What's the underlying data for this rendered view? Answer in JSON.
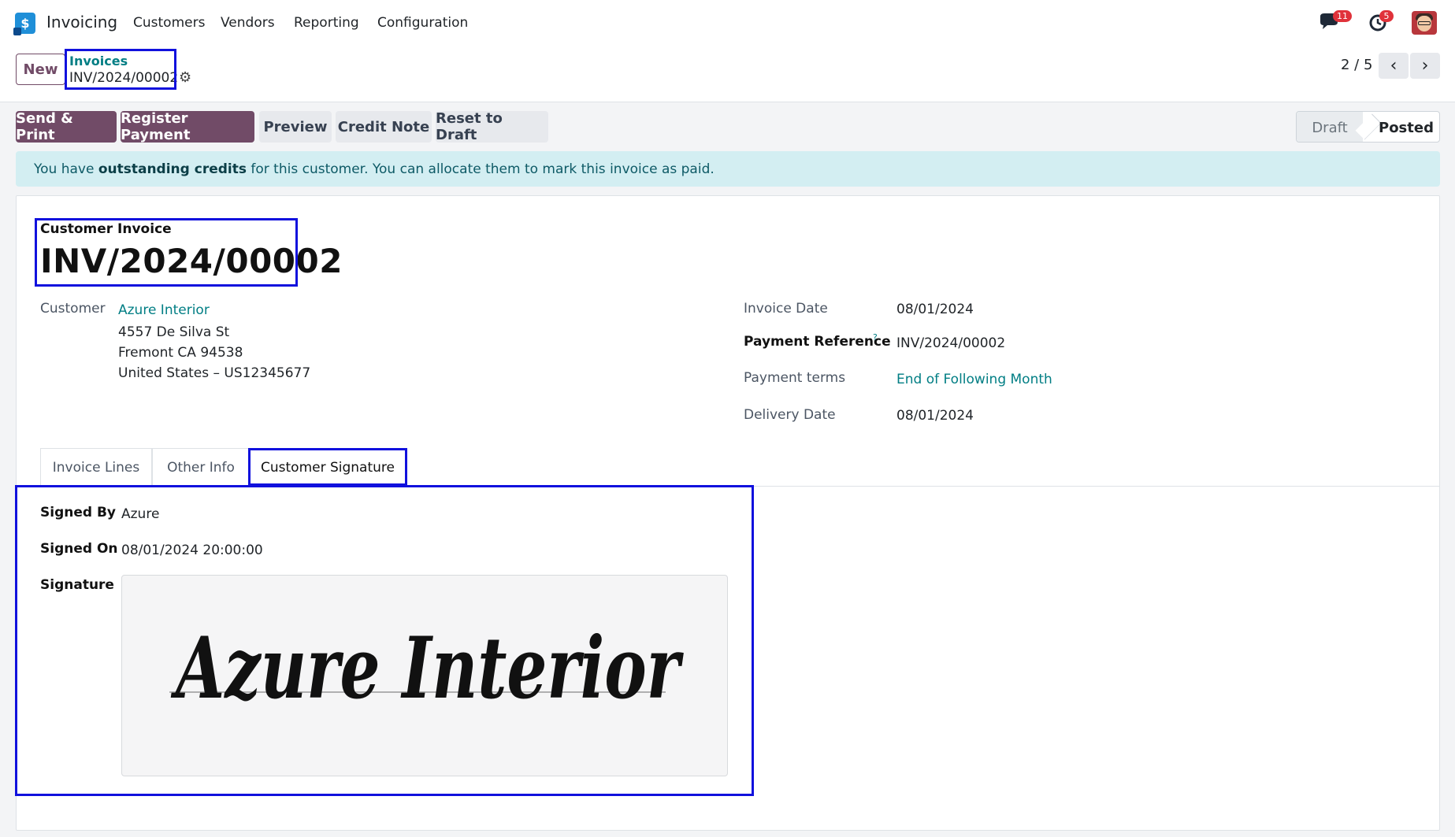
{
  "topbar": {
    "app_name": "Invoicing",
    "logo_glyph": "$",
    "nav": [
      "Customers",
      "Vendors",
      "Reporting",
      "Configuration"
    ],
    "messages_badge": "11",
    "activities_badge": "5"
  },
  "control": {
    "new_label": "New",
    "breadcrumb_parent": "Invoices",
    "breadcrumb_current": "INV/2024/00002",
    "gear_icon": "⚙",
    "pager_value": "2 / 5",
    "prev_glyph": "‹",
    "next_glyph": "›"
  },
  "actions": {
    "send_print": "Send & Print",
    "register_payment": "Register Payment",
    "preview": "Preview",
    "credit_note": "Credit Note",
    "reset_to_draft": "Reset to Draft"
  },
  "status": {
    "draft": "Draft",
    "posted": "Posted",
    "current": "Posted"
  },
  "alert": {
    "prefix": "You have ",
    "bold": "outstanding credits",
    "suffix": " for this customer. You can allocate them to mark this invoice as paid."
  },
  "invoice": {
    "type_label": "Customer Invoice",
    "number": "INV/2024/00002",
    "customer_label": "Customer",
    "customer_name": "Azure Interior",
    "address_line1": "4557 De Silva St",
    "address_line2": "Fremont CA 94538",
    "address_line3": "United States – US12345677",
    "invoice_date_label": "Invoice Date",
    "invoice_date": "08/01/2024",
    "payment_reference_label": "Payment Reference",
    "payment_reference_help": "?",
    "payment_reference": "INV/2024/00002",
    "payment_terms_label": "Payment terms",
    "payment_terms": "End of Following Month",
    "delivery_date_label": "Delivery Date",
    "delivery_date": "08/01/2024"
  },
  "tabs": [
    {
      "label": "Invoice Lines"
    },
    {
      "label": "Other Info"
    },
    {
      "label": "Customer Signature"
    }
  ],
  "signature_panel": {
    "signed_by_label": "Signed By",
    "signed_by": "Azure",
    "signed_on_label": "Signed On",
    "signed_on": "08/01/2024 20:00:00",
    "signature_label": "Signature",
    "signature_text": "Azure Interior"
  },
  "colors": {
    "primary": "#714b67",
    "link": "#017e84",
    "alert_bg": "#d3eef2",
    "highlight": "#1111dd",
    "badge": "#e0323a"
  }
}
